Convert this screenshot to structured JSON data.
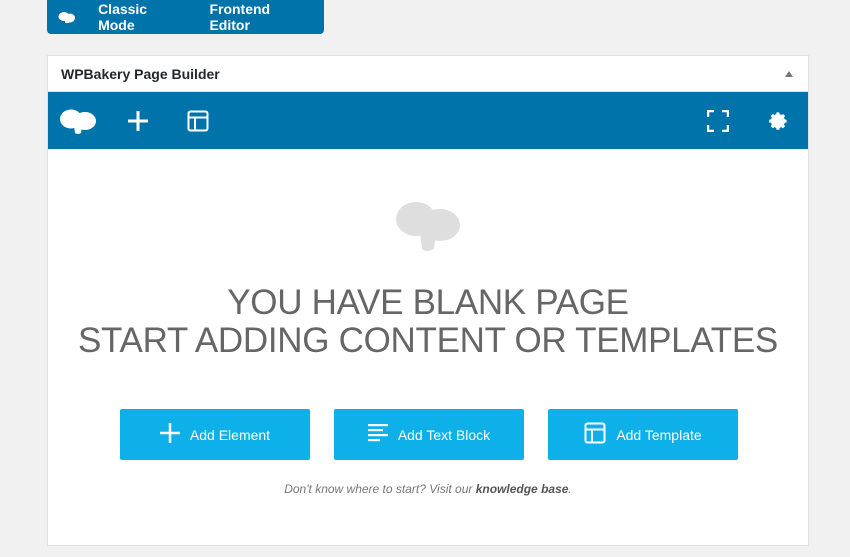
{
  "mode_bar": {
    "classic_label": "Classic Mode",
    "frontend_label": "Frontend Editor"
  },
  "panel": {
    "title": "WPBakery Page Builder"
  },
  "empty_state": {
    "line1": "YOU HAVE BLANK PAGE",
    "line2": "START ADDING CONTENT OR TEMPLATES",
    "buttons": {
      "add_element": "Add Element",
      "add_text_block": "Add Text Block",
      "add_template": "Add Template"
    },
    "hint_prefix": "Don't know where to start? Visit our ",
    "hint_link": "knowledge base",
    "hint_suffix": "."
  },
  "colors": {
    "toolbar": "#0073aa",
    "action_button": "#0eb0e9",
    "headline": "#666666"
  },
  "icons": [
    "wpbakery-logo-icon",
    "plus-icon",
    "template-icon",
    "fullscreen-icon",
    "gear-icon",
    "text-block-icon",
    "collapse-arrow-icon"
  ]
}
